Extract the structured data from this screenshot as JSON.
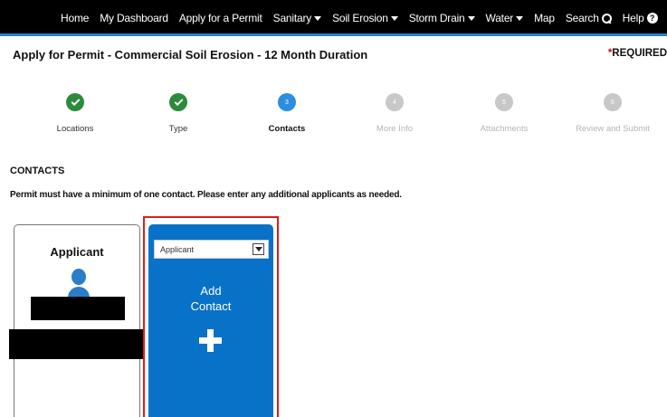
{
  "nav": {
    "items": [
      {
        "label": "Home",
        "has_caret": false
      },
      {
        "label": "My Dashboard",
        "has_caret": false
      },
      {
        "label": "Apply for a Permit",
        "has_caret": false
      },
      {
        "label": "Sanitary",
        "has_caret": true
      },
      {
        "label": "Soil Erosion",
        "has_caret": true
      },
      {
        "label": "Storm Drain",
        "has_caret": true
      },
      {
        "label": "Water",
        "has_caret": true
      },
      {
        "label": "Map",
        "has_caret": false
      },
      {
        "label": "Search",
        "icon": "search-icon"
      },
      {
        "label": "Help",
        "icon": "help-icon"
      }
    ]
  },
  "page": {
    "title": "Apply for Permit - Commercial Soil Erosion - 12 Month Duration",
    "required_star": "*",
    "required_text": "REQUIRED"
  },
  "stepper": {
    "steps": [
      {
        "number": "1",
        "label": "Locations",
        "status": "done"
      },
      {
        "number": "2",
        "label": "Type",
        "status": "done"
      },
      {
        "number": "3",
        "label": "Contacts",
        "status": "current"
      },
      {
        "number": "4",
        "label": "More Info",
        "status": "pending"
      },
      {
        "number": "5",
        "label": "Attachments",
        "status": "pending"
      },
      {
        "number": "6",
        "label": "Review and Submit",
        "status": "pending"
      }
    ]
  },
  "contacts": {
    "section_title": "CONTACTS",
    "instructions": "Permit must have a minimum of one contact. Please enter any additional applicants as needed.",
    "applicant_card": {
      "title": "Applicant"
    },
    "add_card": {
      "select_value": "Applicant",
      "add_line1": "Add",
      "add_line2": "Contact"
    }
  },
  "colors": {
    "nav_bg": "#000000",
    "nav_accent": "#1f84d6",
    "step_done": "#2c8a3c",
    "step_current": "#2a8fe0",
    "step_pending": "#c8c8c8",
    "add_card_bg": "#0872c8",
    "highlight": "#e01b1b"
  }
}
